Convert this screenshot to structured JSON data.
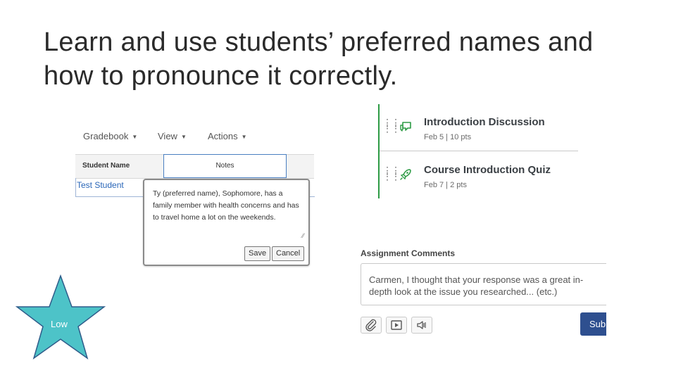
{
  "slide": {
    "title_line1": "Learn and use students’ preferred names and",
    "title_line2": "how to pronounce it correctly."
  },
  "gradebook": {
    "menu": [
      {
        "label": "Gradebook"
      },
      {
        "label": "View"
      },
      {
        "label": "Actions"
      }
    ],
    "columns": [
      "Student Name",
      "Notes"
    ],
    "student_link": "Test Student",
    "note_text": "Ty (preferred name), Sophomore, has a family member with health concerns and has to travel home a lot on the weekends.",
    "save_label": "Save",
    "cancel_label": "Cancel"
  },
  "modules": {
    "items": [
      {
        "name": "Introduction Discussion",
        "meta": "Feb 5  |  10 pts",
        "icon": "discussion-icon"
      },
      {
        "name": "Course Introduction Quiz",
        "meta": "Feb 7  |  2 pts",
        "icon": "quiz-rocket-icon"
      }
    ],
    "accent_color": "#2d9b45"
  },
  "assignment_comments": {
    "label": "Assignment Comments",
    "comment": "Carmen, I thought that your response was a great in-depth look at the issue you researched... (etc.)",
    "tools": [
      "attachment-icon",
      "media-icon",
      "audio-icon"
    ],
    "submit_label": "Submit",
    "submit_color": "#2e4f8f"
  },
  "star": {
    "label": "Low",
    "fill_color": "#4dc3c8",
    "stroke_color": "#2f5c8a"
  }
}
